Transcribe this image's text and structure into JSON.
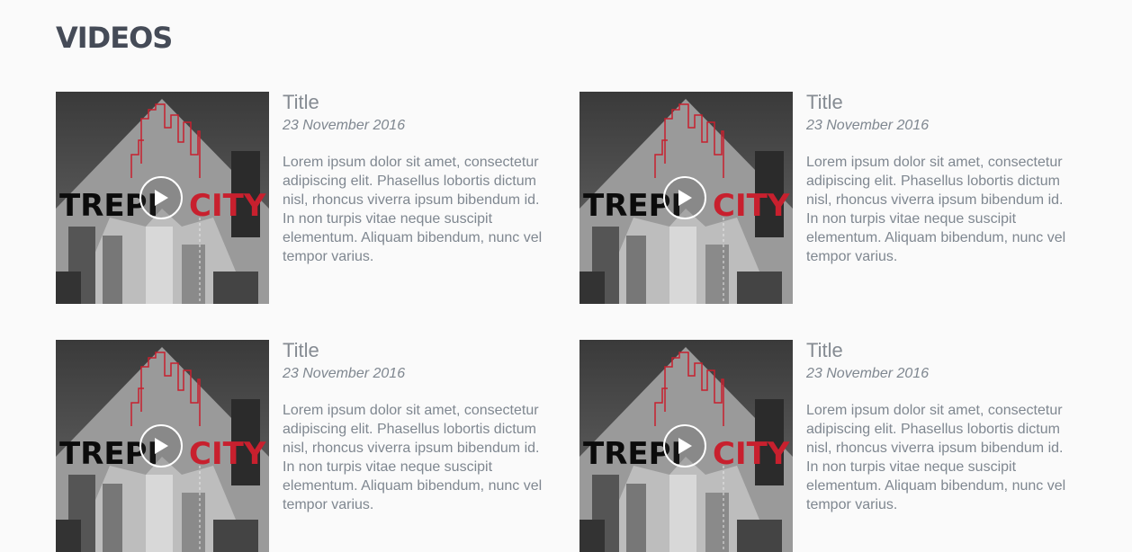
{
  "page": {
    "heading": "VIDEOS"
  },
  "videos": [
    {
      "title": "Title",
      "date": "23 November 2016",
      "description": "Lorem ipsum dolor sit amet, consectetur adipiscing elit. Phasellus lobortis dictum nisl, rhoncus viverra ipsum bibendum id. In non turpis vitae neque suscipit elementum. Aliquam bibendum, nunc vel tempor varius.",
      "thumb_word_left": "TREPI",
      "thumb_word_right": "CITY"
    },
    {
      "title": "Title",
      "date": "23 November 2016",
      "description": "Lorem ipsum dolor sit amet, consectetur adipiscing elit. Phasellus lobortis dictum nisl, rhoncus viverra ipsum bibendum id. In non turpis vitae neque suscipit elementum. Aliquam bibendum, nunc vel tempor varius.",
      "thumb_word_left": "TREPI",
      "thumb_word_right": "CITY"
    },
    {
      "title": "Title",
      "date": "23 November 2016",
      "description": "Lorem ipsum dolor sit amet, consectetur adipiscing elit. Phasellus lobortis dictum nisl, rhoncus viverra ipsum bibendum id. In non turpis vitae neque suscipit elementum. Aliquam bibendum, nunc vel tempor varius.",
      "thumb_word_left": "TREPI",
      "thumb_word_right": "CITY"
    },
    {
      "title": "Title",
      "date": "23 November 2016",
      "description": "Lorem ipsum dolor sit amet, consectetur adipiscing elit. Phasellus lobortis dictum nisl, rhoncus viverra ipsum bibendum id. In non turpis vitae neque suscipit elementum. Aliquam bibendum, nunc vel tempor varius.",
      "thumb_word_left": "TREPI",
      "thumb_word_right": "CITY"
    }
  ],
  "colors": {
    "heading": "#454b57",
    "text": "#7f8790",
    "accent_red": "#c8202e"
  },
  "icons": {
    "play": "play-icon"
  }
}
